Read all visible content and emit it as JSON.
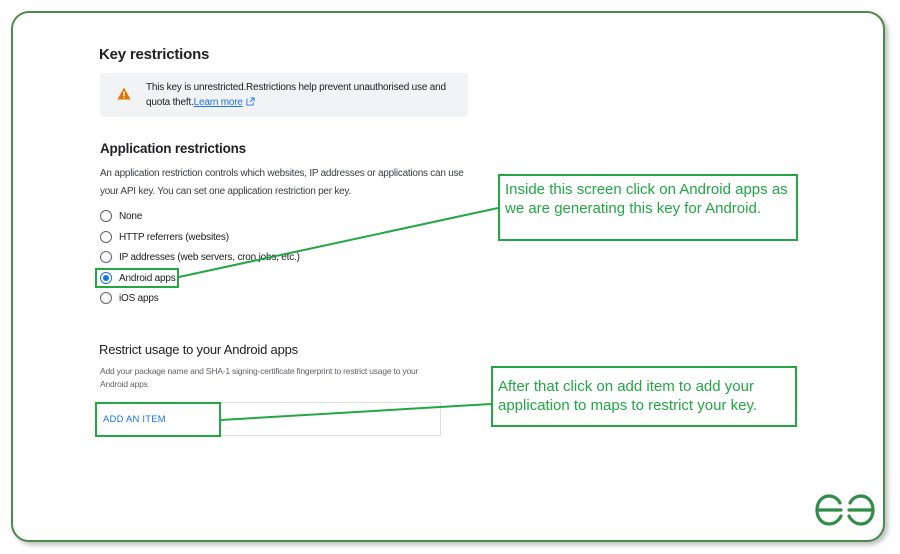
{
  "key_restrictions": {
    "title": "Key restrictions",
    "warning_text": "This key is unrestricted.Restrictions help prevent unauthorised use and quota theft.",
    "learn_more": "Learn more"
  },
  "application_restrictions": {
    "title": "Application restrictions",
    "description": "An application restriction controls which websites, IP addresses or applications can use your API key. You can set one application restriction per key.",
    "options": [
      {
        "label": "None",
        "selected": false
      },
      {
        "label": "HTTP referrers (websites)",
        "selected": false
      },
      {
        "label": "IP addresses (web servers, cron jobs, etc.)",
        "selected": false
      },
      {
        "label": "Android apps",
        "selected": true
      },
      {
        "label": "iOS apps",
        "selected": false
      }
    ]
  },
  "android_restriction": {
    "title": "Restrict usage to your Android apps",
    "description": "Add your package name and SHA-1 signing-certificate fingerprint to restrict usage to your Android apps",
    "add_item_label": "ADD AN ITEM"
  },
  "annotations": {
    "callout_android": "Inside this screen click on Android apps as we are generating this key for Android.",
    "callout_add_item": "After that click on add item to add your application to maps to restrict your key."
  },
  "colors": {
    "annotation_green": "#22a744",
    "link_blue": "#1a73e8",
    "warning_orange": "#e37400",
    "frame_green": "#4a8a4a"
  },
  "icons": {
    "warning": "warning-icon",
    "external_link": "external-link-icon",
    "logo": "gfg-logo"
  }
}
